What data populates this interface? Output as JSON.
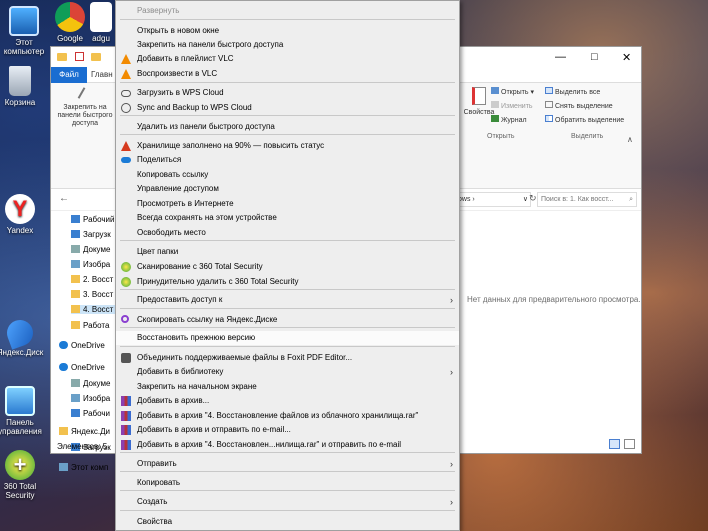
{
  "desktop": {
    "icons": [
      {
        "label": "Этот компьютер"
      },
      {
        "label": "Google"
      },
      {
        "label": "adgu"
      },
      {
        "label": "Корзина"
      },
      {
        "label": "Yandex"
      },
      {
        "label": "Яндекс.Диск"
      },
      {
        "label": "Панель управления"
      },
      {
        "label": "360 Total Security"
      }
    ]
  },
  "explorer": {
    "tab_file": "Файл",
    "tab_home": "Главн",
    "pin_label": "Закрепить на панели быстрого доступа",
    "ribbon": {
      "properties": "Свойства",
      "open": "Открыть",
      "edit": "Изменить",
      "journal": "Журнал",
      "open_group": "Открыть",
      "select_all": "Выделить все",
      "select_none": "Снять выделение",
      "invert": "Обратить выделение",
      "select_group": "Выделить"
    },
    "address_tail": "ows",
    "search_placeholder": "Поиск в: 1. Как восст...",
    "tree": [
      "Рабочий",
      "Загрузк",
      "Докуме",
      "Изобра",
      "2. Восст",
      "3. Восст",
      "4. Восст",
      "Работа",
      "OneDrive",
      "OneDrive",
      "Докуме",
      "Изобра",
      "Рабочи",
      "Яндекс.Ди",
      "Загрузк",
      "Этот комп"
    ],
    "status": "Элементов: 5",
    "preview_empty": "Нет данных для предварительного просмотра."
  },
  "menu": {
    "items": [
      {
        "label": "Развернуть",
        "disabled": true
      },
      {
        "label": "Открыть в новом окне"
      },
      {
        "label": "Закрепить на панели быстрого доступа"
      },
      {
        "label": "Добавить в плейлист VLC",
        "icon": "vlc-cone-icon"
      },
      {
        "label": "Воспроизвести в VLC",
        "icon": "vlc-cone-icon"
      },
      {
        "label": "Загрузить в WPS Cloud",
        "icon": "cloud-outline-icon"
      },
      {
        "label": "Sync and Backup to WPS Cloud",
        "icon": "sync-icon"
      },
      {
        "label": "Удалить из панели быстрого доступа"
      },
      {
        "label": "Хранилище заполнено на 90% — повысить статус",
        "icon": "warning-icon"
      },
      {
        "label": "Поделиться",
        "icon": "onedrive-cloud-icon"
      },
      {
        "label": "Копировать ссылку"
      },
      {
        "label": "Управление доступом"
      },
      {
        "label": "Просмотреть в Интернете"
      },
      {
        "label": "Всегда сохранять на этом устройстве"
      },
      {
        "label": "Освободить место"
      },
      {
        "label": "Цвет папки"
      },
      {
        "label": "Сканирование с 360 Total Security",
        "icon": "360-security-icon"
      },
      {
        "label": "Принудительно удалить с  360 Total Security",
        "icon": "360-security-icon"
      },
      {
        "label": "Предоставить доступ к"
      },
      {
        "label": "Скопировать ссылку на Яндекс.Диске",
        "icon": "yandex-disk-link-icon"
      },
      {
        "label": "Восстановить прежнюю версию"
      },
      {
        "label": "Объединить поддерживаемые файлы в Foxit PDF Editor...",
        "icon": "foxit-icon"
      },
      {
        "label": "Добавить в библиотеку"
      },
      {
        "label": "Закрепить на начальном экране"
      },
      {
        "label": "Добавить в архив...",
        "icon": "winrar-icon"
      },
      {
        "label": "Добавить в архив \"4. Восстановление файлов из облачного хранилища.rar\"",
        "icon": "winrar-icon"
      },
      {
        "label": "Добавить в архив и отправить по e-mail...",
        "icon": "winrar-icon"
      },
      {
        "label": "Добавить в архив \"4. Восстановлен...нилища.rar\" и отправить по e-mail",
        "icon": "winrar-icon"
      },
      {
        "label": "Отправить"
      },
      {
        "label": "Копировать"
      },
      {
        "label": "Создать"
      },
      {
        "label": "Свойства"
      }
    ]
  },
  "colors": {
    "accent": "#1a6dd1",
    "vlc": "#f28a00",
    "warning": "#d63a1e",
    "onedrive": "#1b7bd6",
    "green360": "#3aa83a",
    "winrar": "#b5333a"
  }
}
